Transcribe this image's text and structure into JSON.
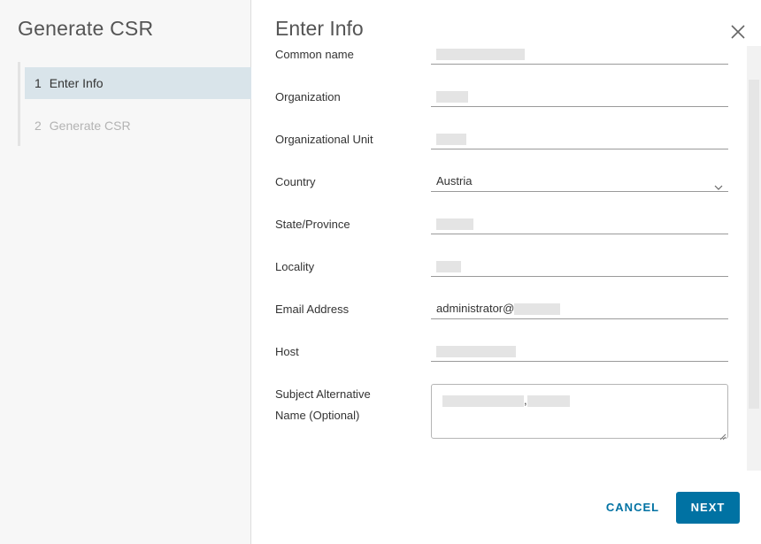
{
  "wizard": {
    "title": "Generate CSR",
    "steps": [
      {
        "number": "1",
        "label": "Enter Info",
        "active": true
      },
      {
        "number": "2",
        "label": "Generate CSR",
        "active": false
      }
    ]
  },
  "panel": {
    "title": "Enter Info",
    "close_icon": "close-icon"
  },
  "form": {
    "common_name": {
      "label": "Common name",
      "value": ""
    },
    "organization": {
      "label": "Organization",
      "value": ""
    },
    "organizational_unit": {
      "label": "Organizational Unit",
      "value": ""
    },
    "country": {
      "label": "Country",
      "value": "Austria"
    },
    "state_province": {
      "label": "State/Province",
      "value": ""
    },
    "locality": {
      "label": "Locality",
      "value": ""
    },
    "email_address": {
      "label": "Email Address",
      "value": "administrator@"
    },
    "host": {
      "label": "Host",
      "value": ""
    },
    "san": {
      "label_line1": "Subject Alternative",
      "label_line2": "Name (Optional)",
      "value": ","
    }
  },
  "buttons": {
    "cancel": "CANCEL",
    "next": "NEXT"
  },
  "colors": {
    "accent": "#0072a3",
    "active_step_bg": "#d9e4ea",
    "left_pane_bg": "#f7f7f7"
  }
}
